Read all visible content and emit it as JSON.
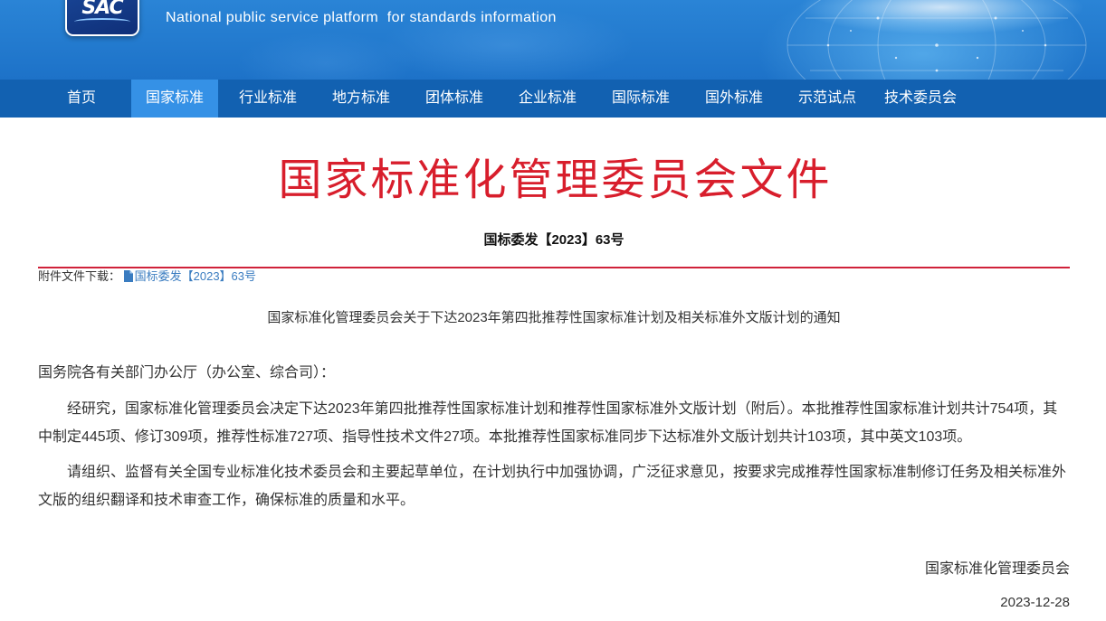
{
  "header": {
    "logo_text": "SAC",
    "subtitle_en": "National public service platform  for standards information"
  },
  "nav": {
    "items": [
      {
        "label": "首页",
        "active": false
      },
      {
        "label": "国家标准",
        "active": true
      },
      {
        "label": "行业标准",
        "active": false
      },
      {
        "label": "地方标准",
        "active": false
      },
      {
        "label": "团体标准",
        "active": false
      },
      {
        "label": "企业标准",
        "active": false
      },
      {
        "label": "国际标准",
        "active": false
      },
      {
        "label": "国外标准",
        "active": false
      },
      {
        "label": "示范试点",
        "active": false
      },
      {
        "label": "技术委员会",
        "active": false
      }
    ]
  },
  "doc": {
    "title": "国家标准化管理委员会文件",
    "number": "国标委发【2023】63号",
    "attachment_label": "附件文件下载：",
    "attachment_link": "国标委发【2023】63号",
    "notice_title": "国家标准化管理委员会关于下达2023年第四批推荐性国家标准计划及相关标准外文版计划的通知",
    "salutation": "国务院各有关部门办公厅（办公室、综合司）：",
    "paragraphs": [
      "经研究，国家标准化管理委员会决定下达2023年第四批推荐性国家标准计划和推荐性国家标准外文版计划（附后）。本批推荐性国家标准计划共计754项，其中制定445项、修订309项，推荐性标准727项、指导性技术文件27项。本批推荐性国家标准同步下达标准外文版计划共计103项，其中英文103项。",
      "请组织、监督有关全国专业标准化技术委员会和主要起草单位，在计划执行中加强协调，广泛征求意见，按要求完成推荐性国家标准制修订任务及相关标准外文版的组织翻译和技术审查工作，确保标准的质量和水平。"
    ],
    "signature": "国家标准化管理委员会",
    "date": "2023-12-28"
  },
  "colors": {
    "title_red": "#d81e2c",
    "nav_bg": "#1261b1",
    "nav_active_bg": "#3591e6",
    "link": "#3a7cc0",
    "rule_red": "#d0223a"
  },
  "icons": {
    "attachment": "file-icon",
    "logo": "sac-logo"
  }
}
